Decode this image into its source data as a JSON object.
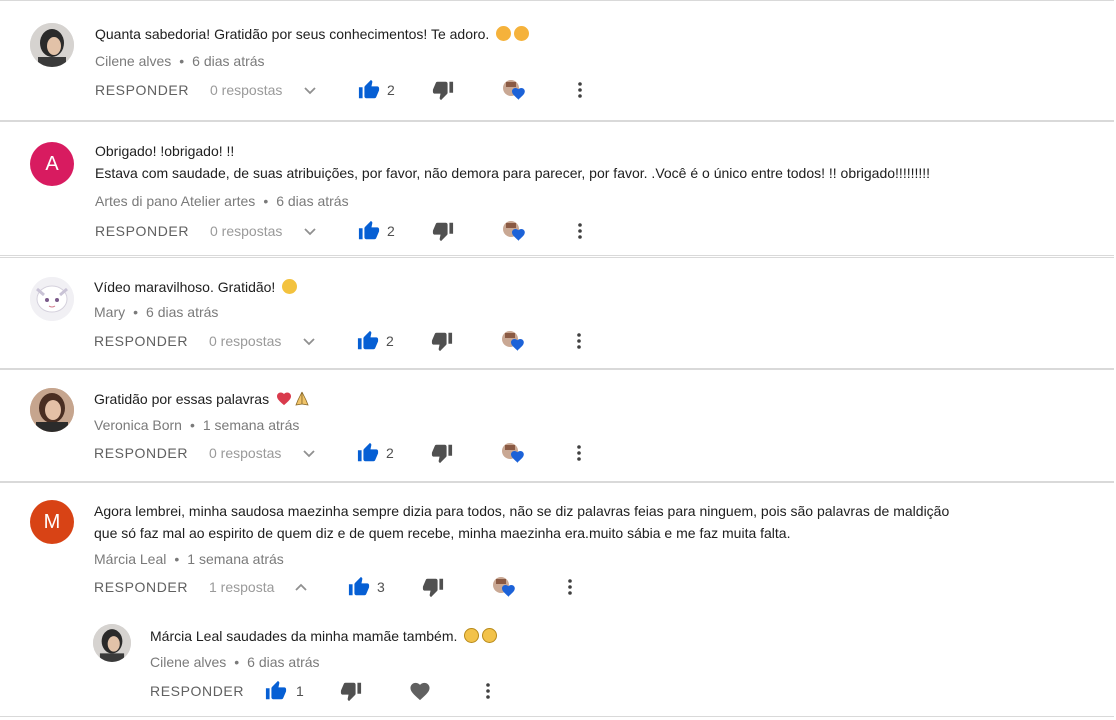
{
  "labels": {
    "reply": "RESPONDER"
  },
  "icons": [
    "thumbs-up-icon",
    "thumbs-down-icon",
    "creator-heart-icon",
    "more-vert-icon",
    "chevron-down-icon",
    "chevron-up-icon",
    "heart-icon"
  ],
  "colors": {
    "like_blue": "#065fd4",
    "avatar_a": "#d81b60",
    "avatar_m": "#d84315",
    "heart_blue": "#1c62d8"
  },
  "comments": [
    {
      "author": "Cilene alves",
      "time": "6 dias atrás",
      "lines": [
        "Quanta sabedoria! Gratidão por seus conhecimentos! Te adoro."
      ],
      "replies": "0 respostas",
      "likes": "2",
      "avatar_letter": ""
    },
    {
      "author": "Artes di pano Atelier artes",
      "time": "6 dias atrás",
      "lines": [
        "Obrigado! !obrigado! !!",
        "Estava com saudade, de suas atribuições, por favor, não demora para parecer, por favor. .Você é o único entre todos! !! obrigado!!!!!!!!!"
      ],
      "replies": "0 respostas",
      "likes": "2",
      "avatar_letter": "A"
    },
    {
      "author": "Mary",
      "time": "6 dias atrás",
      "lines": [
        "Vídeo maravilhoso.  Gratidão!"
      ],
      "replies": "0 respostas",
      "likes": "2",
      "avatar_letter": ""
    },
    {
      "author": "Veronica Born",
      "time": "1 semana atrás",
      "lines": [
        "Gratidão por essas palavras"
      ],
      "replies": "0 respostas",
      "likes": "2",
      "avatar_letter": ""
    },
    {
      "author": "Márcia Leal",
      "time": "1 semana atrás",
      "lines": [
        "Agora lembrei, minha saudosa maezinha sempre dizia para todos, não se diz palavras feias para ninguem, pois são palavras de maldição",
        "que só faz mal ao espirito de quem diz e de quem recebe, minha maezinha era.muito sábia e me faz muita falta."
      ],
      "replies": "1 resposta",
      "likes": "3",
      "avatar_letter": "M"
    }
  ],
  "reply": {
    "author": "Cilene alves",
    "time": "6 dias atrás",
    "text": "Márcia Leal saudades da minha mamãe também.",
    "likes": "1"
  }
}
